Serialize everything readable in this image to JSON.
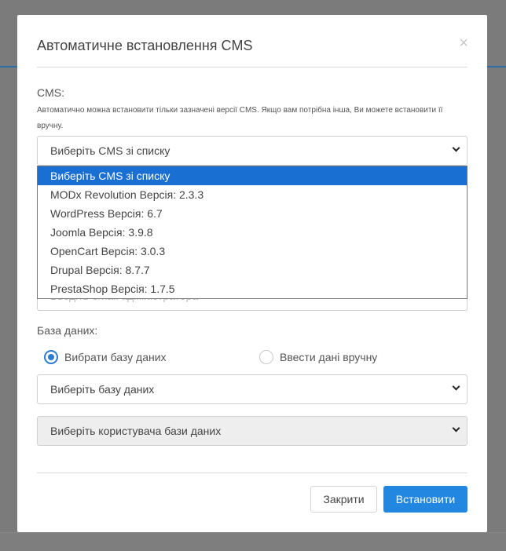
{
  "modal": {
    "title": "Автоматичне встановлення CMS",
    "close_symbol": "×"
  },
  "cms": {
    "label": "CMS:",
    "hint": "Автоматично можна встановити тільки зазначені версії CMS. Якщо вам потрібна інша, Ви можете встановити її вручну.",
    "selected": "Виберіть CMS зі списку",
    "options": [
      "Виберіть CMS зі списку",
      "MODx Revolution Версія: 2.3.3",
      "WordPress Версія: 6.7",
      "Joomla Версія: 3.9.8",
      "OpenCart Версія: 3.0.3",
      "Drupal Версія: 8.7.7",
      "PrestaShop Версія: 1.7.5"
    ]
  },
  "admin_email": {
    "placeholder": "Введіть email адміністратора"
  },
  "database": {
    "label": "База даних:",
    "radio_select": "Вибрати базу даних",
    "radio_manual": "Ввести дані вручну",
    "db_select": "Виберіть базу даних",
    "user_select": "Виберіть користувача бази даних"
  },
  "footer": {
    "close_label": "Закрити",
    "install_label": "Встановити"
  },
  "colors": {
    "accent": "#2187e1",
    "dropdown_selected": "#1a6fd2"
  }
}
